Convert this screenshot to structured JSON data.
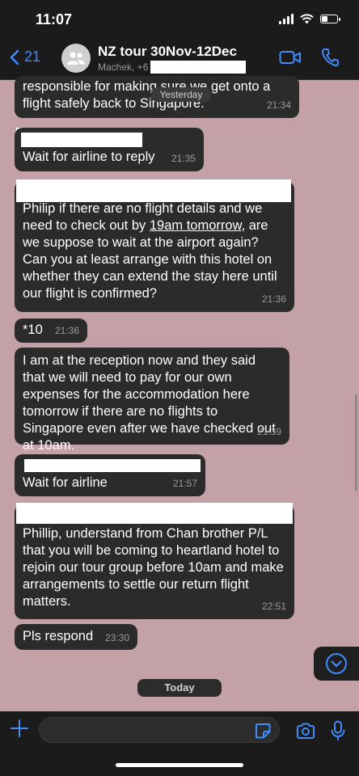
{
  "status_bar": {
    "time": "11:07",
    "battery_level": 0.35
  },
  "header": {
    "back_count": "21",
    "chat_title": "NZ tour 30Nov-12Dec",
    "subtitle": "Machek, +6"
  },
  "date_separators": {
    "previous": "Yesterday",
    "current": "Today"
  },
  "messages": [
    {
      "text_lines": [
        "responsible for making sure we get onto a",
        "flight safely back to Singapore."
      ],
      "time": "21:34"
    },
    {
      "text": "Wait for airline to reply",
      "time": "21:35"
    },
    {
      "text_part1": "Philip if there are no flight details and we need to check out by ",
      "text_underlined": "19am tomorrow",
      "text_part2": ", are we suppose to wait at the airport again? Can you at least arrange with this hotel on whether they can extend the stay here until our flight is confirmed?",
      "time": "21:36"
    },
    {
      "text": "*10",
      "time": "21:36"
    },
    {
      "text": "I am at the reception now and they said that we will need to pay for our own expenses for the accommodation here tomorrow if there are no flights to Singapore even after we have checked out at 10am.",
      "time": "21:39"
    },
    {
      "text": "Wait for airline",
      "time": "21:57"
    },
    {
      "text": "Phillip, understand from Chan brother P/L that you will be coming to heartland hotel to rejoin our tour group before 10am and make arrangements to settle our return flight matters.",
      "time": "22:51"
    },
    {
      "text": "Pls respond",
      "time": "23:30"
    }
  ],
  "colors": {
    "background": "#c4a1a7",
    "bubble": "#2b2b2b",
    "bar": "#1b1b1b",
    "accent": "#3f8cff"
  },
  "icons": {
    "back": "chevron-left-icon",
    "group": "group-avatar-icon",
    "video": "video-call-icon",
    "call": "phone-icon",
    "scroll": "chevron-down-icon",
    "plus": "plus-icon",
    "sticker": "sticker-icon",
    "camera": "camera-icon",
    "mic": "microphone-icon"
  }
}
